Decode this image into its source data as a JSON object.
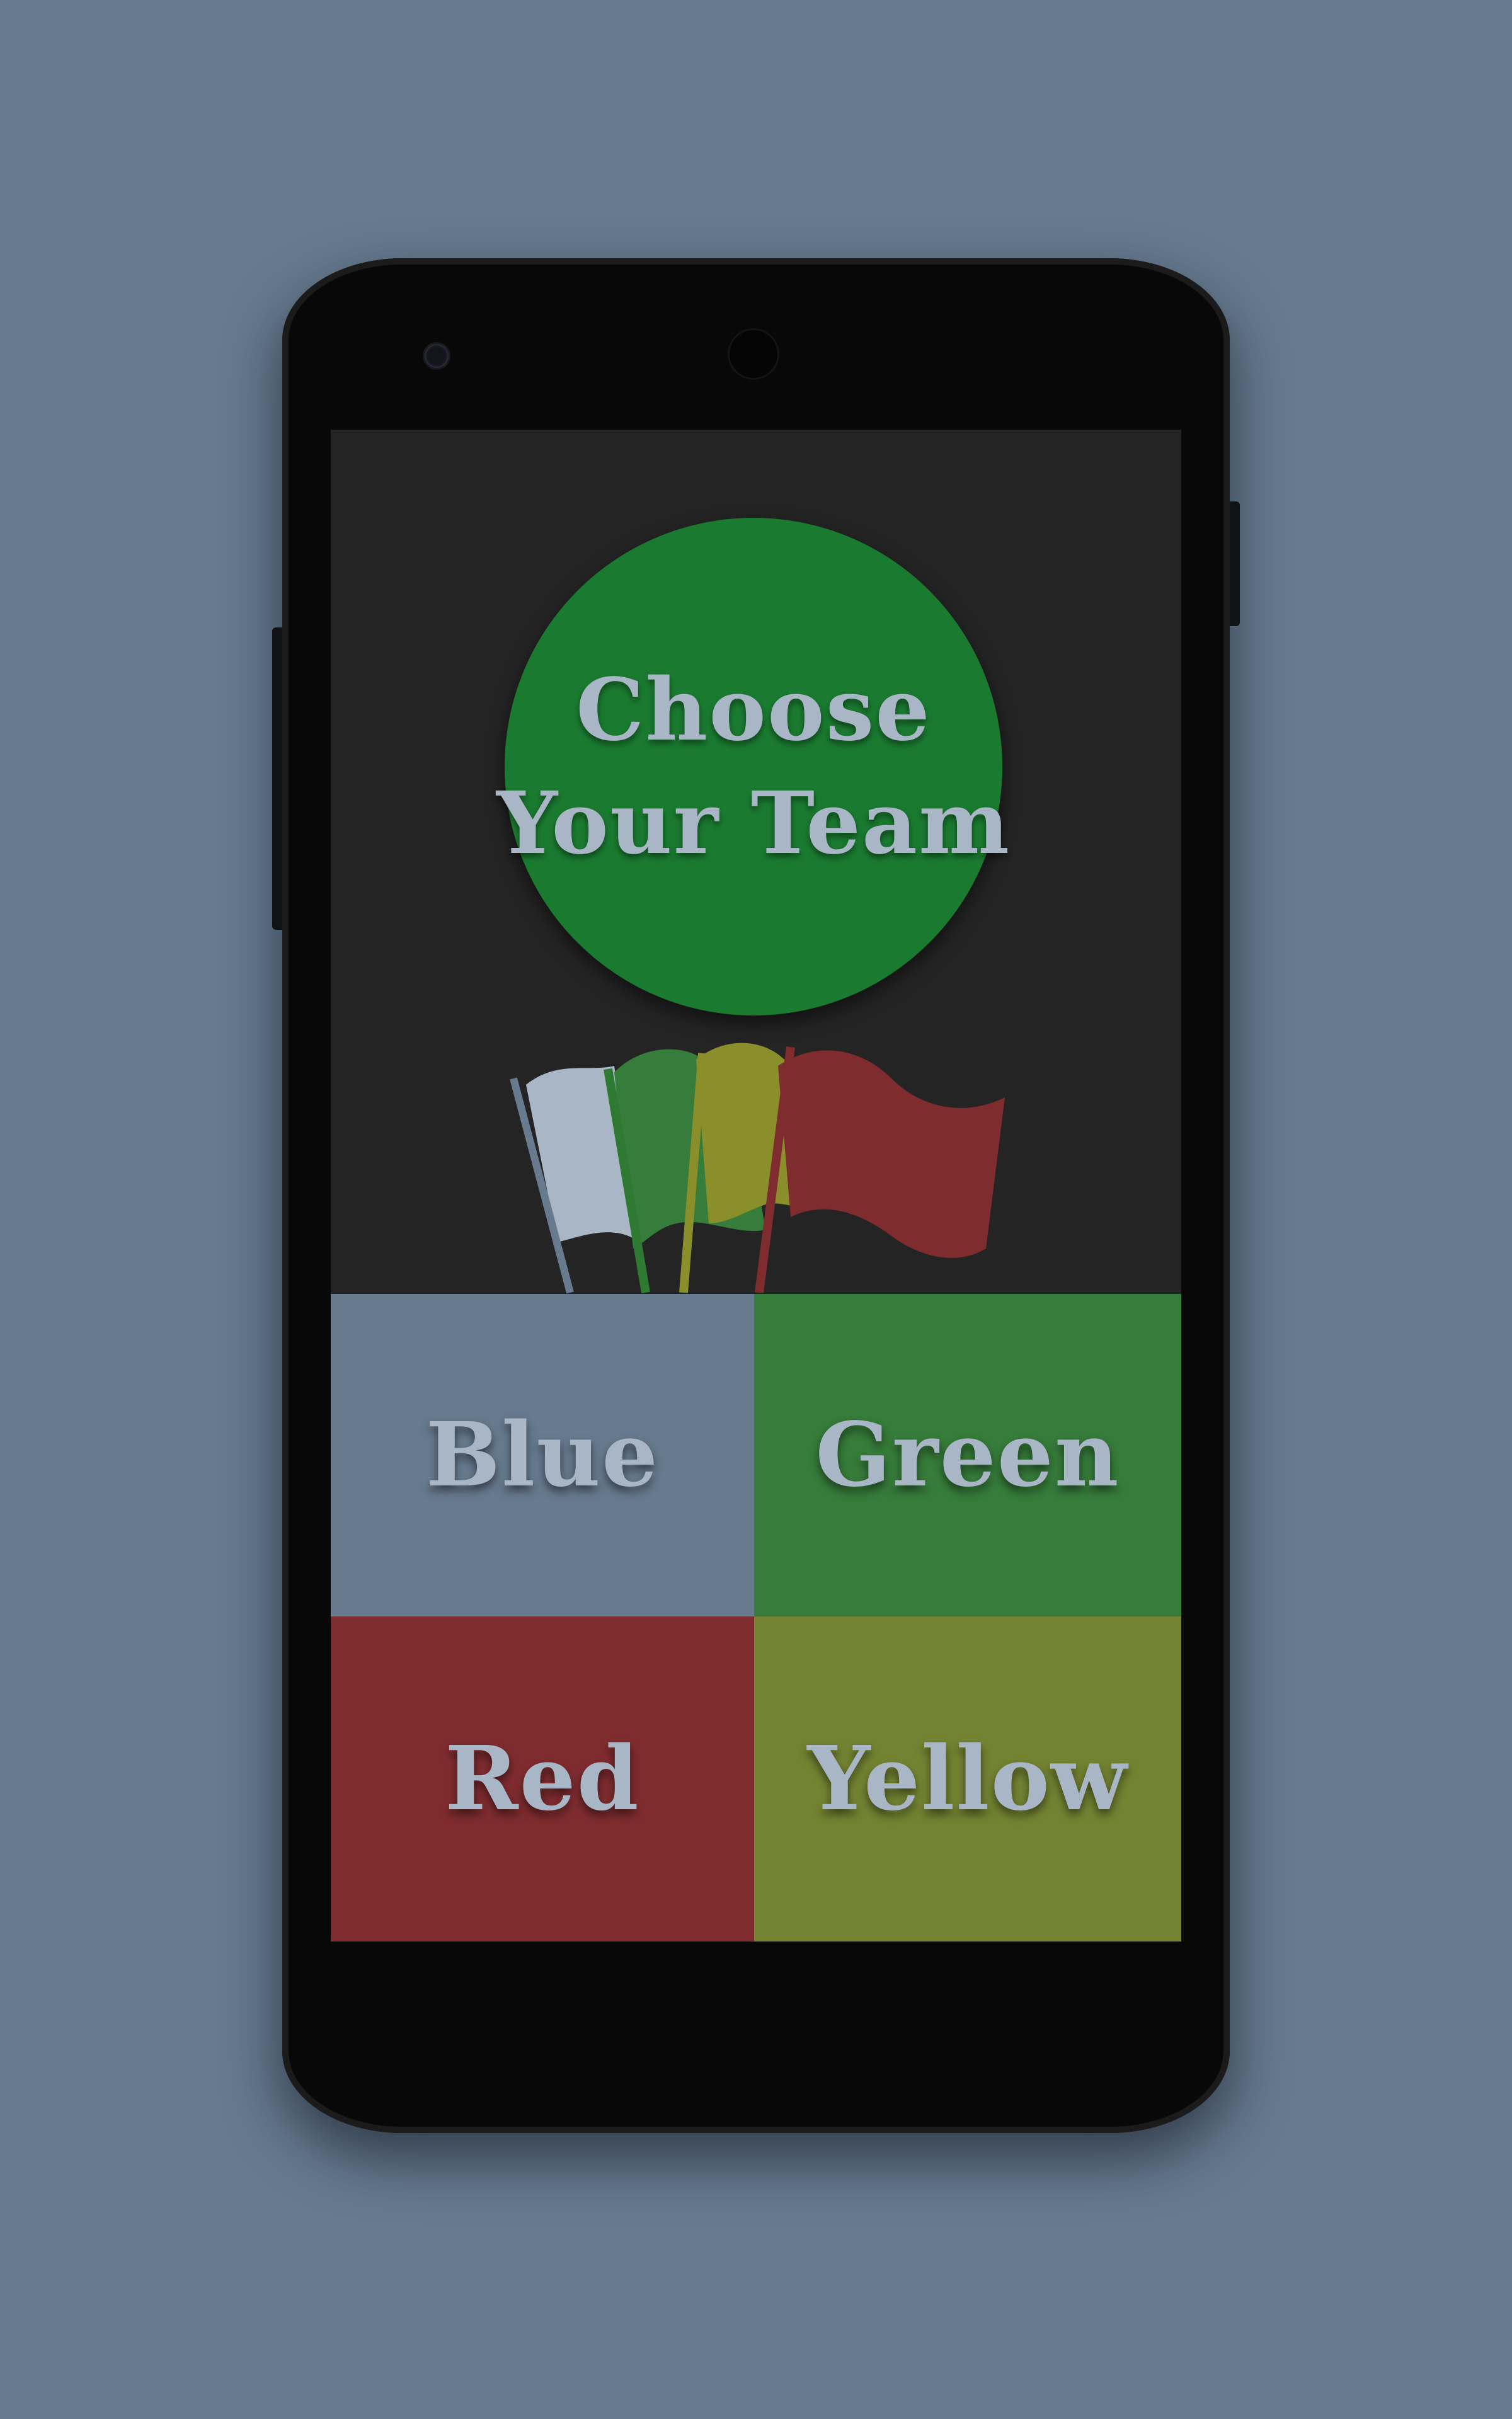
{
  "title": {
    "line1": "Choose",
    "line2": "Your Team"
  },
  "flags_illustration": {
    "icon": "team-flags-icon",
    "colors": [
      "#a8b6c5",
      "#367c3a",
      "#8a8f2c",
      "#7f2c2f"
    ]
  },
  "teams": [
    {
      "label": "Blue",
      "color": "#677a8e"
    },
    {
      "label": "Green",
      "color": "#367c3a"
    },
    {
      "label": "Red",
      "color": "#7f2c2f"
    },
    {
      "label": "Yellow",
      "color": "#748332"
    }
  ],
  "colors": {
    "background": "#677a8e",
    "screen": "#242424",
    "title_circle": "#1a7b30",
    "text": "#a8b6c5"
  }
}
